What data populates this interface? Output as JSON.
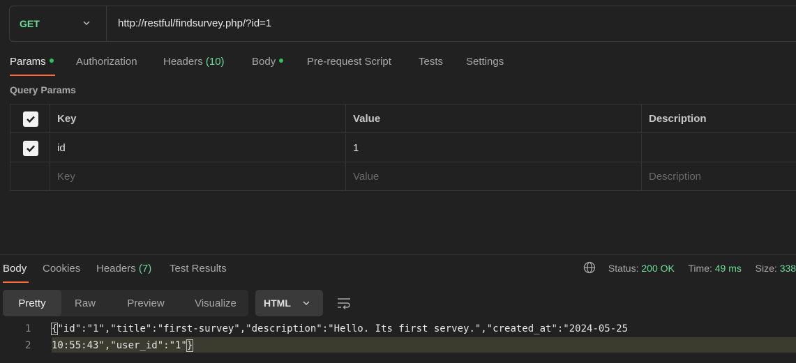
{
  "request": {
    "method": "GET",
    "url": "http://restful/findsurvey.php/?id=1"
  },
  "request_tabs": {
    "params": "Params",
    "authorization": "Authorization",
    "headers": "Headers",
    "headers_count": "(10)",
    "body": "Body",
    "pre_request": "Pre-request Script",
    "tests": "Tests",
    "settings": "Settings"
  },
  "query_params": {
    "title": "Query Params",
    "columns": {
      "key": "Key",
      "value": "Value",
      "description": "Description"
    },
    "rows": [
      {
        "checked": true,
        "key": "id",
        "value": "1",
        "description": ""
      }
    ],
    "placeholder": {
      "key": "Key",
      "value": "Value",
      "description": "Description"
    }
  },
  "response_tabs": {
    "body": "Body",
    "cookies": "Cookies",
    "headers": "Headers",
    "headers_count": "(7)",
    "test_results": "Test Results"
  },
  "status": {
    "status_label": "Status:",
    "status_value": "200 OK",
    "time_label": "Time:",
    "time_value": "49 ms",
    "size_label": "Size:",
    "size_value": "338"
  },
  "view_modes": {
    "pretty": "Pretty",
    "raw": "Raw",
    "preview": "Preview",
    "visualize": "Visualize"
  },
  "format": "HTML",
  "code": {
    "line1_num": "1",
    "line2_num": "2",
    "line1_open": "{",
    "line1_rest": "\"id\":\"1\",\"title\":\"first-survey\",\"description\":\"Hello. Its first servey.\",\"created_at\":\"2024-05-25",
    "line2_rest": "10:55:43\",\"user_id\":\"1\"",
    "line2_close": "}"
  },
  "colors": {
    "accent": "#ff6c37",
    "method_green": "#6bdd9a",
    "dot_green": "#2ec45a"
  }
}
